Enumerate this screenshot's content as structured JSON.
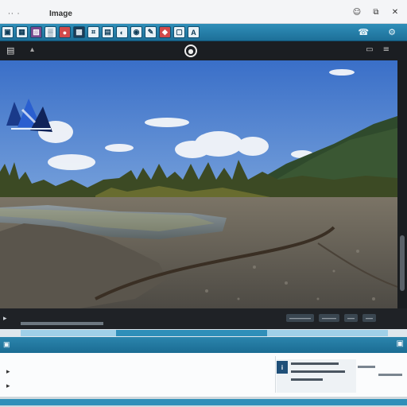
{
  "window": {
    "app_dots": "··  ·",
    "title": "Image",
    "controls": [
      "☺",
      "⧉",
      "✕"
    ]
  },
  "toolbar": {
    "tools": [
      {
        "icon": "window-icon",
        "glyph": "▣",
        "style": "default"
      },
      {
        "icon": "image-icon",
        "glyph": "▦",
        "style": "default"
      },
      {
        "icon": "photo-icon",
        "glyph": "▨",
        "style": "purple"
      },
      {
        "icon": "grid-icon",
        "glyph": "▒",
        "style": "default"
      },
      {
        "icon": "record-icon",
        "glyph": "●",
        "style": "red"
      },
      {
        "icon": "film-icon",
        "glyph": "▩",
        "style": "dark"
      },
      {
        "icon": "crop-icon",
        "glyph": "⌗",
        "style": "default"
      },
      {
        "icon": "layers-icon",
        "glyph": "▤",
        "style": "default"
      },
      {
        "icon": "adjust-icon",
        "glyph": "◐",
        "style": "default"
      },
      {
        "icon": "eye-icon",
        "glyph": "◉",
        "style": "default"
      },
      {
        "icon": "brush-icon",
        "glyph": "✎",
        "style": "default"
      },
      {
        "icon": "color-icon",
        "glyph": "◆",
        "style": "red"
      },
      {
        "icon": "frame-icon",
        "glyph": "▢",
        "style": "default"
      },
      {
        "icon": "text-icon",
        "glyph": "A",
        "style": "default"
      }
    ],
    "right_icons": [
      "☎",
      "⚙"
    ]
  },
  "viewer": {
    "left_glyph": "▤",
    "left_glyph2": "▴",
    "center_glyph": "●",
    "right_glyphs": [
      "▭",
      "≡"
    ]
  },
  "status": {
    "left_glyph": "▸",
    "right_pills": [
      "———",
      "——",
      "—",
      "—"
    ]
  },
  "bottom_panel": {
    "header_left": "▣",
    "header_right": "▣",
    "left_items": [
      "▸",
      "▸"
    ],
    "detail_icon": "i"
  },
  "colors": {
    "accent": "#2f8fb9",
    "accent_dark": "#1d6f98",
    "viewer_bg": "#1b1e22"
  }
}
